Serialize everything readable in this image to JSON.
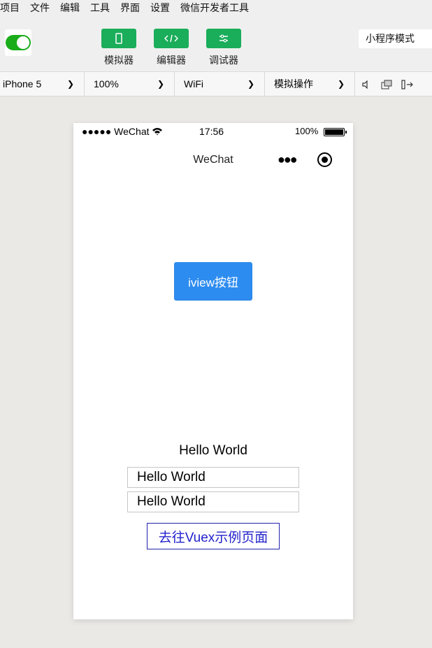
{
  "menubar": {
    "items": [
      "项目",
      "文件",
      "编辑",
      "工具",
      "界面",
      "设置",
      "微信开发者工具"
    ]
  },
  "toolbar": {
    "simulator_label": "模拟器",
    "editor_label": "编辑器",
    "debugger_label": "调试器",
    "mode_select": "小程序模式",
    "accent_color": "#1aad5a"
  },
  "device_bar": {
    "device": "iPhone 5",
    "zoom": "100%",
    "network": "WiFi",
    "operation": "模拟操作"
  },
  "phone": {
    "status": {
      "carrier": "●●●●● WeChat",
      "time": "17:56",
      "battery": "100%"
    },
    "nav_title": "WeChat",
    "iview_button": "iview按钮",
    "hello_text": "Hello World",
    "input1_value": "Hello World",
    "input2_value": "Hello World",
    "vuex_link": "去往Vuex示例页面"
  }
}
